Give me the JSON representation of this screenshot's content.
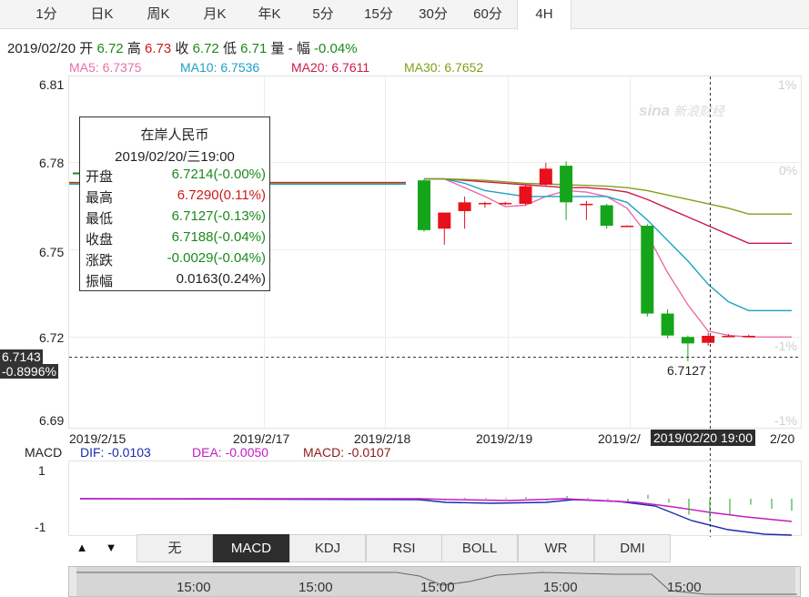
{
  "tabs": [
    {
      "label": "1分"
    },
    {
      "label": "日K"
    },
    {
      "label": "周K"
    },
    {
      "label": "月K"
    },
    {
      "label": "年K"
    },
    {
      "label": "5分"
    },
    {
      "label": "15分"
    },
    {
      "label": "30分"
    },
    {
      "label": "60分"
    },
    {
      "label": "4H",
      "active": true
    }
  ],
  "info": {
    "date": "2019/02/20",
    "open_label": "开",
    "open": "6.72",
    "high_label": "高",
    "high": "6.73",
    "close_label": "收",
    "close": "6.72",
    "low_label": "低",
    "low": "6.71",
    "volume_label": "量",
    "volume": "-",
    "amplitude_label": "幅",
    "amplitude": "-0.04%"
  },
  "ma": [
    {
      "label": "MA5: 6.7375",
      "color": "#e86fa6"
    },
    {
      "label": "MA10: 6.7536",
      "color": "#1aa2c8"
    },
    {
      "label": "MA20: 6.7611",
      "color": "#cc1a4a"
    },
    {
      "label": "MA30: 6.7652",
      "color": "#7fa01a"
    }
  ],
  "watermark": "新浪财经",
  "price_axis": [
    "6.81",
    "6.78",
    "6.75",
    "6.72",
    "6.69"
  ],
  "pct_axis": [
    "1%",
    "0%",
    "-1%",
    "-1%"
  ],
  "date_axis": [
    "2019/2/15",
    "2019/2/17",
    "2019/2/18",
    "2019/2/19",
    "2019/2/",
    "2/20"
  ],
  "crosshair": {
    "time_label": "2019/02/20 19:00",
    "price_box": "6.7143",
    "pct_box": "-0.8996%",
    "low_marker": "6.7127"
  },
  "tooltip": {
    "title": "在岸人民币",
    "datetime": "2019/02/20/三19:00",
    "rows": [
      {
        "k": "开盘",
        "v": "6.7214(-0.00%)",
        "color": "#1a8a1a"
      },
      {
        "k": "最高",
        "v": "6.7290(0.11%)",
        "color": "#cc1a1a"
      },
      {
        "k": "最低",
        "v": "6.7127(-0.13%)",
        "color": "#1a8a1a"
      },
      {
        "k": "收盘",
        "v": "6.7188(-0.04%)",
        "color": "#1a8a1a"
      },
      {
        "k": "涨跌",
        "v": "-0.0029(-0.04%)",
        "color": "#1a8a1a"
      },
      {
        "k": "振幅",
        "v": "0.0163(0.24%)",
        "color": "#222222"
      }
    ]
  },
  "macd": {
    "label": "MACD",
    "dif": "DIF: -0.0103",
    "dif_color": "#1a2ab0",
    "dea": "DEA: -0.0050",
    "dea_color": "#c41ac4",
    "macd": "MACD: -0.0107",
    "macd_color": "#8a1a1a",
    "axis_top": "1",
    "axis_bottom": "-1"
  },
  "indicator_buttons": [
    {
      "label": "无"
    },
    {
      "label": "MACD",
      "active": true
    },
    {
      "label": "KDJ"
    },
    {
      "label": "RSI"
    },
    {
      "label": "BOLL"
    },
    {
      "label": "WR"
    },
    {
      "label": "DMI"
    }
  ],
  "nav_arrows": {
    "up": "▲",
    "down": "▼"
  },
  "navigator_ticks": [
    "15:00",
    "15:00",
    "15:00",
    "15:00",
    "15:00"
  ],
  "chart_data": {
    "type": "candlestick",
    "ylim": [
      6.69,
      6.81
    ],
    "candles": [
      {
        "o": 6.7755,
        "h": 6.7755,
        "l": 6.774,
        "c": 6.775
      },
      {
        "o": 6.774,
        "h": 6.7745,
        "l": 6.7735,
        "c": 6.774
      },
      {
        "o": 6.7745,
        "h": 6.7745,
        "l": 6.774,
        "c": 6.7745
      },
      {
        "o": 6.775,
        "h": 6.775,
        "l": 6.7745,
        "c": 6.7748
      },
      {
        "o": 6.774,
        "h": 6.7745,
        "l": 6.7738,
        "c": 6.7742
      },
      {
        "o": 6.774,
        "h": 6.7745,
        "l": 6.7738,
        "c": 6.7742
      },
      {
        "o": 6.774,
        "h": 6.7742,
        "l": 6.7738,
        "c": 6.774
      },
      {
        "o": 6.774,
        "h": 6.7742,
        "l": 6.7738,
        "c": 6.774
      },
      {
        "o": 6.774,
        "h": 6.7742,
        "l": 6.7738,
        "c": 6.774
      },
      {
        "o": 6.774,
        "h": 6.7742,
        "l": 6.7738,
        "c": 6.774
      },
      {
        "o": 6.774,
        "h": 6.7742,
        "l": 6.7738,
        "c": 6.774
      },
      {
        "o": 6.774,
        "h": 6.7742,
        "l": 6.7738,
        "c": 6.774
      },
      {
        "o": 6.774,
        "h": 6.7742,
        "l": 6.7738,
        "c": 6.774
      },
      {
        "o": 6.774,
        "h": 6.7742,
        "l": 6.7738,
        "c": 6.774
      },
      {
        "o": 6.774,
        "h": 6.7742,
        "l": 6.7738,
        "c": 6.774
      },
      {
        "o": 6.774,
        "h": 6.7742,
        "l": 6.7738,
        "c": 6.774
      },
      {
        "o": 6.774,
        "h": 6.7742,
        "l": 6.7738,
        "c": 6.774
      },
      {
        "o": 6.774,
        "h": 6.7742,
        "l": 6.7738,
        "c": 6.774
      },
      {
        "o": 6.774,
        "h": 6.7742,
        "l": 6.7738,
        "c": 6.774
      },
      {
        "o": 6.774,
        "h": 6.7742,
        "l": 6.7738,
        "c": 6.774
      },
      {
        "o": 6.774,
        "h": 6.7742,
        "l": 6.7738,
        "c": 6.774
      },
      {
        "o": 6.774,
        "h": 6.7742,
        "l": 6.7738,
        "c": 6.774
      },
      {
        "o": 6.774,
        "h": 6.7742,
        "l": 6.7738,
        "c": 6.774
      },
      {
        "o": 6.774,
        "h": 6.7742,
        "l": 6.7738,
        "c": 6.774
      },
      {
        "o": 6.774,
        "h": 6.7742,
        "l": 6.7738,
        "c": 6.774
      },
      {
        "o": 6.774,
        "h": 6.7742,
        "l": 6.7738,
        "c": 6.774
      },
      {
        "o": 6.774,
        "h": 6.7742,
        "l": 6.7738,
        "c": 6.774
      },
      {
        "o": 6.774,
        "h": 6.7742,
        "l": 6.7738,
        "c": 6.774
      },
      {
        "o": 6.774,
        "h": 6.7742,
        "l": 6.7738,
        "c": 6.774
      },
      {
        "o": 6.774,
        "h": 6.7742,
        "l": 6.7738,
        "c": 6.774
      },
      {
        "o": 6.774,
        "h": 6.7742,
        "l": 6.7738,
        "c": 6.774
      },
      {
        "o": 6.774,
        "h": 6.7742,
        "l": 6.7738,
        "c": 6.774
      },
      {
        "o": 6.774,
        "h": 6.7742,
        "l": 6.7738,
        "c": 6.774
      },
      {
        "o": 6.774,
        "h": 6.7742,
        "l": 6.7738,
        "c": 6.774
      },
      {
        "o": 6.774,
        "h": 6.7742,
        "l": 6.7738,
        "c": 6.774
      },
      {
        "o": 6.774,
        "h": 6.7742,
        "l": 6.7738,
        "c": 6.774
      },
      {
        "o": 6.774,
        "h": 6.7742,
        "l": 6.7738,
        "c": 6.774
      },
      {
        "o": 6.774,
        "h": 6.7742,
        "l": 6.7738,
        "c": 6.774
      },
      {
        "o": 6.774,
        "h": 6.7742,
        "l": 6.7738,
        "c": 6.774
      },
      {
        "o": 6.774,
        "h": 6.7742,
        "l": 6.7738,
        "c": 6.774
      },
      {
        "o": 6.774,
        "h": 6.7742,
        "l": 6.7738,
        "c": 6.774
      },
      {
        "o": 6.774,
        "h": 6.7742,
        "l": 6.7738,
        "c": 6.774
      },
      {
        "o": 6.774,
        "h": 6.7742,
        "l": 6.7738,
        "c": 6.774
      },
      {
        "o": 6.774,
        "h": 6.7742,
        "l": 6.7738,
        "c": 6.774
      },
      {
        "o": 6.774,
        "h": 6.7742,
        "l": 6.7738,
        "c": 6.774
      },
      {
        "o": 6.774,
        "h": 6.7742,
        "l": 6.7738,
        "c": 6.774
      },
      {
        "o": 6.774,
        "h": 6.7742,
        "l": 6.7738,
        "c": 6.774
      },
      {
        "o": 6.774,
        "h": 6.7742,
        "l": 6.7738,
        "c": 6.774
      },
      {
        "o": 6.774,
        "h": 6.7742,
        "l": 6.7738,
        "c": 6.774
      },
      {
        "o": 6.774,
        "h": 6.7742,
        "l": 6.7738,
        "c": 6.774
      },
      {
        "o": 6.774,
        "h": 6.7742,
        "l": 6.7738,
        "c": 6.774
      },
      {
        "o": 6.774,
        "h": 6.7742,
        "l": 6.7738,
        "c": 6.774
      },
      {
        "o": 6.774,
        "h": 6.7742,
        "l": 6.7738,
        "c": 6.774
      },
      {
        "o": 6.774,
        "h": 6.7742,
        "l": 6.7738,
        "c": 6.774
      },
      {
        "o": 6.774,
        "h": 6.7742,
        "l": 6.7738,
        "c": 6.774
      },
      {
        "o": 6.774,
        "h": 6.7742,
        "l": 6.7738,
        "c": 6.774
      },
      {
        "o": 6.774,
        "h": 6.7742,
        "l": 6.7738,
        "c": 6.774
      },
      {
        "o": 6.774,
        "h": 6.7742,
        "l": 6.7738,
        "c": 6.774
      },
      {
        "o": 6.774,
        "h": 6.7742,
        "l": 6.7738,
        "c": 6.774
      },
      {
        "o": 6.774,
        "h": 6.7742,
        "l": 6.7738,
        "c": 6.774
      },
      {
        "o": 6.774,
        "h": 6.7742,
        "l": 6.7738,
        "c": 6.774
      },
      {
        "o": 6.774,
        "h": 6.7742,
        "l": 6.7738,
        "c": 6.774
      },
      {
        "o": 6.774,
        "h": 6.7742,
        "l": 6.7738,
        "c": 6.774
      },
      {
        "o": 6.774,
        "h": 6.7742,
        "l": 6.7738,
        "c": 6.774
      },
      {
        "o": 6.774,
        "h": 6.7742,
        "l": 6.7738,
        "c": 6.774
      },
      {
        "o": 6.774,
        "h": 6.7742,
        "l": 6.7738,
        "c": 6.774
      },
      {
        "o": 6.774,
        "h": 6.7742,
        "l": 6.7738,
        "c": 6.774
      },
      {
        "o": 6.774,
        "h": 6.7742,
        "l": 6.7738,
        "c": 6.774
      },
      {
        "o": 6.774,
        "h": 6.7742,
        "l": 6.7738,
        "c": 6.774
      },
      {
        "o": 6.774,
        "h": 6.7742,
        "l": 6.7738,
        "c": 6.774
      },
      {
        "o": 6.774,
        "h": 6.7742,
        "l": 6.7738,
        "c": 6.774
      },
      {
        "o": 6.774,
        "h": 6.7742,
        "l": 6.7738,
        "c": 6.774
      },
      {
        "o": 6.774,
        "h": 6.7742,
        "l": 6.7738,
        "c": 6.774
      },
      {
        "o": 6.774,
        "h": 6.7742,
        "l": 6.7738,
        "c": 6.774
      },
      {
        "o": 6.774,
        "h": 6.7742,
        "l": 6.7738,
        "c": 6.774
      },
      {
        "o": 6.774,
        "h": 6.7742,
        "l": 6.7738,
        "c": 6.774
      },
      {
        "o": 6.774,
        "h": 6.7742,
        "l": 6.7738,
        "c": 6.774
      },
      {
        "o": 6.774,
        "h": 6.7742,
        "l": 6.7738,
        "c": 6.774
      },
      {
        "o": 6.774,
        "h": 6.7742,
        "l": 6.7738,
        "c": 6.774
      },
      {
        "o": 6.774,
        "h": 6.7742,
        "l": 6.7738,
        "c": 6.774
      },
      {
        "o": 6.774,
        "h": 6.7742,
        "l": 6.7738,
        "c": 6.774
      },
      {
        "o": 6.774,
        "h": 6.7742,
        "l": 6.7738,
        "c": 6.774
      },
      {
        "o": 6.774,
        "h": 6.7742,
        "l": 6.7738,
        "c": 6.774
      },
      {
        "o": 6.774,
        "h": 6.7742,
        "l": 6.7738,
        "c": 6.774
      },
      {
        "o": 6.774,
        "h": 6.7742,
        "l": 6.7738,
        "c": 6.774
      },
      {
        "o": 6.774,
        "h": 6.7742,
        "l": 6.7738,
        "c": 6.774
      },
      {
        "o": 6.774,
        "h": 6.7742,
        "l": 6.7738,
        "c": 6.774
      },
      {
        "o": 6.774,
        "h": 6.7742,
        "l": 6.7738,
        "c": 6.774
      },
      {
        "o": 6.774,
        "h": 6.7742,
        "l": 6.7738,
        "c": 6.774
      },
      {
        "o": 6.774,
        "h": 6.7742,
        "l": 6.7738,
        "c": 6.774
      },
      {
        "o": 6.774,
        "h": 6.7742,
        "l": 6.7738,
        "c": 6.774
      },
      {
        "o": 6.774,
        "h": 6.7742,
        "l": 6.7738,
        "c": 6.774
      },
      {
        "o": 6.774,
        "h": 6.7742,
        "l": 6.7738,
        "c": 6.774
      },
      {
        "o": 6.774,
        "h": 6.7742,
        "l": 6.7738,
        "c": 6.774
      },
      {
        "o": 6.774,
        "h": 6.7742,
        "l": 6.7738,
        "c": 6.774
      },
      {
        "o": 6.774,
        "h": 6.7742,
        "l": 6.7738,
        "c": 6.774
      },
      {
        "o": 6.774,
        "h": 6.7742,
        "l": 6.7738,
        "c": 6.774
      },
      {
        "o": 6.774,
        "h": 6.7742,
        "l": 6.7738,
        "c": 6.774
      },
      {
        "o": 6.774,
        "h": 6.7742,
        "l": 6.7738,
        "c": 6.774
      },
      {
        "o": 6.774,
        "h": 6.7742,
        "l": 6.7738,
        "c": 6.774
      },
      {
        "o": 6.774,
        "h": 6.7742,
        "l": 6.7738,
        "c": 6.774
      },
      {
        "o": 6.774,
        "h": 6.7742,
        "l": 6.7738,
        "c": 6.774
      },
      {
        "o": 6.774,
        "h": 6.7742,
        "l": 6.7738,
        "c": 6.774
      },
      {
        "o": 6.774,
        "h": 6.7742,
        "l": 6.7738,
        "c": 6.774
      },
      {
        "o": 6.774,
        "h": 6.7742,
        "l": 6.7738,
        "c": 6.774
      },
      {
        "o": 6.774,
        "h": 6.7742,
        "l": 6.7738,
        "c": 6.774
      },
      {
        "o": 6.774,
        "h": 6.7742,
        "l": 6.7738,
        "c": 6.774
      },
      {
        "o": 6.774,
        "h": 6.7742,
        "l": 6.7738,
        "c": 6.774
      },
      {
        "o": 6.774,
        "h": 6.7742,
        "l": 6.7738,
        "c": 6.774
      },
      {
        "o": 6.774,
        "h": 6.7742,
        "l": 6.7738,
        "c": 6.774
      },
      {
        "o": 6.774,
        "h": 6.7742,
        "l": 6.7738,
        "c": 6.774
      },
      {
        "o": 6.774,
        "h": 6.7742,
        "l": 6.7738,
        "c": 6.774
      },
      {
        "o": 6.774,
        "h": 6.7742,
        "l": 6.7738,
        "c": 6.774
      },
      {
        "o": 6.774,
        "h": 6.7742,
        "l": 6.7738,
        "c": 6.774
      },
      {
        "o": 6.774,
        "h": 6.7742,
        "l": 6.7738,
        "c": 6.774
      },
      {
        "o": 6.774,
        "h": 6.7742,
        "l": 6.7738,
        "c": 6.774
      },
      {
        "o": 6.774,
        "h": 6.7742,
        "l": 6.7738,
        "c": 6.774
      },
      {
        "o": 6.774,
        "h": 6.7742,
        "l": 6.7738,
        "c": 6.774
      },
      {
        "o": 6.774,
        "h": 6.7742,
        "l": 6.7738,
        "c": 6.774
      },
      {
        "o": 6.774,
        "h": 6.7742,
        "l": 6.7738,
        "c": 6.774
      },
      {
        "o": 6.774,
        "h": 6.7742,
        "l": 6.7738,
        "c": 6.774
      },
      {
        "o": 6.774,
        "h": 6.7742,
        "l": 6.7738,
        "c": 6.774
      },
      {
        "o": 6.774,
        "h": 6.7742,
        "l": 6.7738,
        "c": 6.774
      },
      {
        "o": 6.774,
        "h": 6.7742,
        "l": 6.7738,
        "c": 6.774
      },
      {
        "o": 6.774,
        "h": 6.7742,
        "l": 6.7738,
        "c": 6.774
      },
      {
        "o": 6.774,
        "h": 6.7742,
        "l": 6.7738,
        "c": 6.774
      },
      {
        "o": 6.774,
        "h": 6.7742,
        "l": 6.7738,
        "c": 6.774
      },
      {
        "o": 6.774,
        "h": 6.7742,
        "l": 6.7738,
        "c": 6.774
      },
      {
        "o": 6.774,
        "h": 6.7742,
        "l": 6.7738,
        "c": 6.774
      },
      {
        "o": 6.774,
        "h": 6.7742,
        "l": 6.7738,
        "c": 6.774
      }
    ],
    "visible_candles": [
      {
        "o": 6.7745,
        "h": 6.775,
        "l": 6.757,
        "c": 6.7575
      },
      {
        "o": 6.758,
        "h": 6.759,
        "l": 6.7525,
        "c": 6.7635
      },
      {
        "o": 6.764,
        "h": 6.769,
        "l": 6.758,
        "c": 6.767
      },
      {
        "o": 6.7665,
        "h": 6.7672,
        "l": 6.7652,
        "c": 6.7668
      },
      {
        "o": 6.7668,
        "h": 6.7672,
        "l": 6.766,
        "c": 6.7668
      },
      {
        "o": 6.7665,
        "h": 6.773,
        "l": 6.766,
        "c": 6.7725
      },
      {
        "o": 6.773,
        "h": 6.7805,
        "l": 6.7725,
        "c": 6.7785
      },
      {
        "o": 6.7795,
        "h": 6.781,
        "l": 6.761,
        "c": 6.767
      },
      {
        "o": 6.7665,
        "h": 6.7675,
        "l": 6.761,
        "c": 6.7665
      },
      {
        "o": 6.766,
        "h": 6.7665,
        "l": 6.758,
        "c": 6.759
      },
      {
        "o": 6.759,
        "h": 6.7592,
        "l": 6.7588,
        "c": 6.759
      },
      {
        "o": 6.759,
        "h": 6.7595,
        "l": 6.728,
        "c": 6.729
      },
      {
        "o": 6.729,
        "h": 6.7305,
        "l": 6.7205,
        "c": 6.7215
      },
      {
        "o": 6.721,
        "h": 6.7215,
        "l": 6.7127,
        "c": 6.7188
      },
      {
        "o": 6.719,
        "h": 6.7225,
        "l": 6.718,
        "c": 6.7214
      },
      {
        "o": 6.7214,
        "h": 6.722,
        "l": 6.721,
        "c": 6.7214
      },
      {
        "o": 6.7214,
        "h": 6.7218,
        "l": 6.7212,
        "c": 6.7214
      }
    ],
    "ma_lines": {
      "ma5": [
        6.775,
        6.775,
        6.772,
        6.769,
        6.7655,
        6.766,
        6.769,
        6.771,
        6.7705,
        6.769,
        6.765,
        6.756,
        6.743,
        6.732,
        6.723,
        6.7216,
        6.721
      ],
      "ma10": [
        6.775,
        6.775,
        6.7735,
        6.771,
        6.77,
        6.769,
        6.769,
        6.769,
        6.769,
        6.769,
        6.767,
        6.761,
        6.754,
        6.747,
        6.739,
        6.733,
        6.73
      ],
      "ma20": [
        6.775,
        6.775,
        6.7745,
        6.774,
        6.7735,
        6.773,
        6.7725,
        6.772,
        6.772,
        6.7715,
        6.7705,
        6.768,
        6.765,
        6.762,
        6.759,
        6.756,
        6.753
      ],
      "ma30": [
        6.775,
        6.775,
        6.7748,
        6.7745,
        6.774,
        6.7735,
        6.7733,
        6.773,
        6.7728,
        6.7725,
        6.772,
        6.771,
        6.7695,
        6.768,
        6.7665,
        6.765,
        6.763
      ]
    }
  }
}
